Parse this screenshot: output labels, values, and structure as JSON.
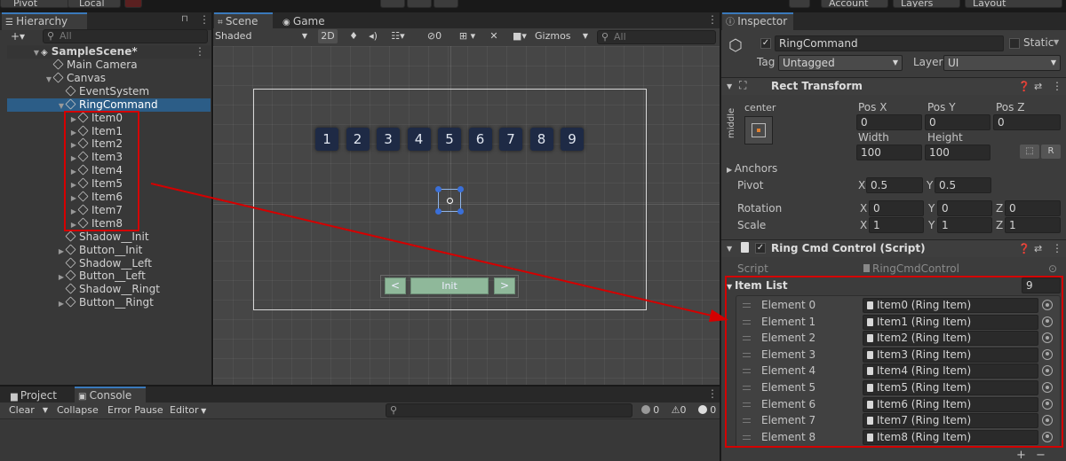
{
  "toolbar": {
    "pivot": "Pivot",
    "local": "Local",
    "account": "Account",
    "layers": "Layers",
    "layout": "Layout"
  },
  "hierarchy": {
    "tab": "Hierarchy",
    "add": "+▾",
    "search_placeholder": "All",
    "scene": "SampleScene*",
    "items": [
      {
        "label": "Main Camera"
      },
      {
        "label": "Canvas"
      },
      {
        "label": "EventSystem"
      },
      {
        "label": "RingCommand"
      },
      {
        "label": "Item0"
      },
      {
        "label": "Item1"
      },
      {
        "label": "Item2"
      },
      {
        "label": "Item3"
      },
      {
        "label": "Item4"
      },
      {
        "label": "Item5"
      },
      {
        "label": "Item6"
      },
      {
        "label": "Item7"
      },
      {
        "label": "Item8"
      },
      {
        "label": "Shadow__Init"
      },
      {
        "label": "Button__Init"
      },
      {
        "label": "Shadow__Left"
      },
      {
        "label": "Button__Left"
      },
      {
        "label": "Shadow__Ringt"
      },
      {
        "label": "Button__Ringt"
      }
    ]
  },
  "scene": {
    "tabs": {
      "scene": "Scene",
      "game": "Game"
    },
    "shading": "Shaded",
    "mode_2d": "2D",
    "gizmos": "Gizmos",
    "search_placeholder": "All",
    "tiles": [
      "1",
      "2",
      "3",
      "4",
      "5",
      "6",
      "7",
      "8",
      "9"
    ],
    "buttons": {
      "left": "<",
      "init": "Init",
      "right": ">"
    }
  },
  "console": {
    "tabs": {
      "project": "Project",
      "console": "Console"
    },
    "clear": "Clear",
    "collapse": "Collapse",
    "error_pause": "Error Pause",
    "editor": "Editor",
    "counts": {
      "info": "0",
      "warn": "0",
      "error": "0"
    }
  },
  "inspector": {
    "tab": "Inspector",
    "object_name": "RingCommand",
    "static_label": "Static",
    "tag_label": "Tag",
    "tag_value": "Untagged",
    "layer_label": "Layer",
    "layer_value": "UI",
    "rect_transform": {
      "title": "Rect Transform",
      "anchor_h": "center",
      "anchor_v": "middle",
      "pos_x_label": "Pos X",
      "pos_x": "0",
      "pos_y_label": "Pos Y",
      "pos_y": "0",
      "pos_z_label": "Pos Z",
      "pos_z": "0",
      "width_label": "Width",
      "width": "100",
      "height_label": "Height",
      "height": "100",
      "r_btn": "R",
      "anchors": "Anchors",
      "pivot": "Pivot",
      "pivot_x": "0.5",
      "pivot_y": "0.5",
      "rotation": "Rotation",
      "rot_x": "0",
      "rot_y": "0",
      "rot_z": "0",
      "scale": "Scale",
      "scale_x": "1",
      "scale_y": "1",
      "scale_z": "1",
      "x": "X",
      "y": "Y",
      "z": "Z"
    },
    "script_component": {
      "title": "Ring Cmd Control (Script)",
      "script_label": "Script",
      "script_value": "RingCmdControl",
      "list_label": "Item List",
      "list_count": "9",
      "elements": [
        {
          "label": "Element 0",
          "value": "Item0 (Ring Item)"
        },
        {
          "label": "Element 1",
          "value": "Item1 (Ring Item)"
        },
        {
          "label": "Element 2",
          "value": "Item2 (Ring Item)"
        },
        {
          "label": "Element 3",
          "value": "Item3 (Ring Item)"
        },
        {
          "label": "Element 4",
          "value": "Item4 (Ring Item)"
        },
        {
          "label": "Element 5",
          "value": "Item5 (Ring Item)"
        },
        {
          "label": "Element 6",
          "value": "Item6 (Ring Item)"
        },
        {
          "label": "Element 7",
          "value": "Item7 (Ring Item)"
        },
        {
          "label": "Element 8",
          "value": "Item8 (Ring Item)"
        }
      ],
      "add": "+",
      "remove": "−"
    }
  },
  "colors": {
    "annotation_red": "#d40000",
    "selection_blue": "#2c5d87",
    "tile_navy": "#1e2a45",
    "button_green": "#8fb89a"
  }
}
